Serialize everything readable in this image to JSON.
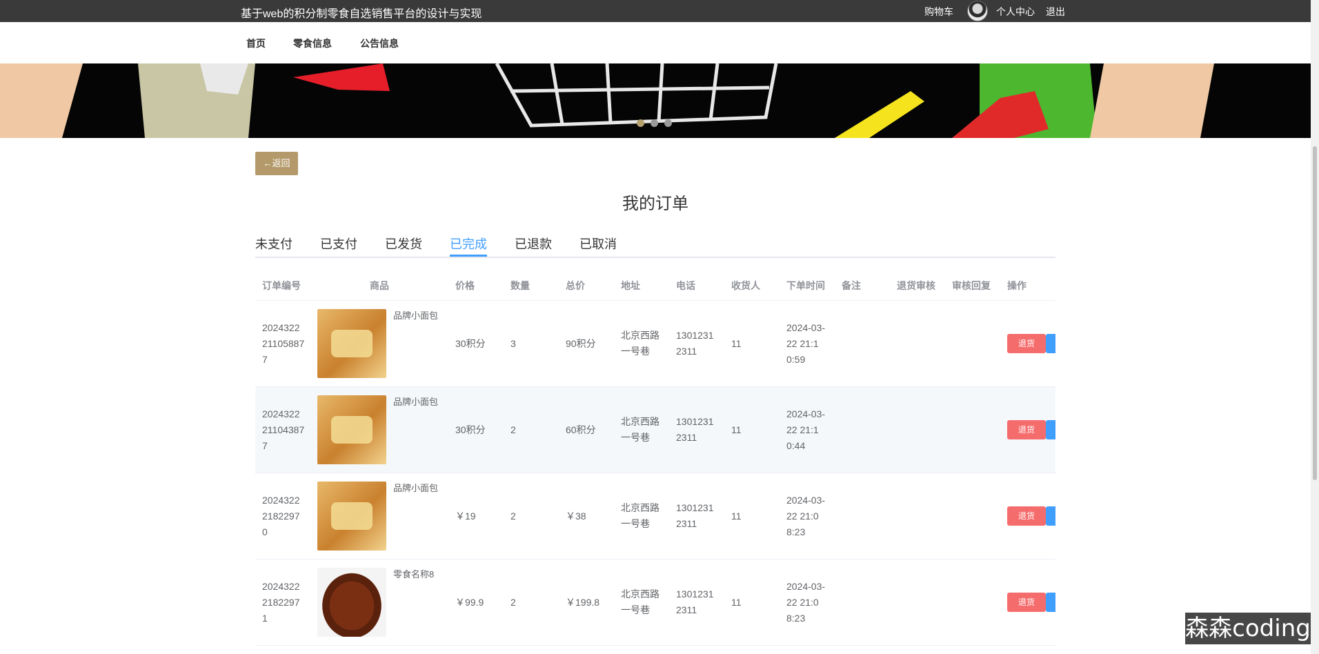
{
  "header": {
    "site_title": "基于web的积分制零食自选销售平台的设计与实现",
    "cart": "购物车",
    "user_center": "个人中心",
    "logout": "退出"
  },
  "nav": {
    "items": [
      "首页",
      "零食信息",
      "公告信息"
    ]
  },
  "banner": {
    "active_dot": 0,
    "dot_count": 3
  },
  "page": {
    "back_label": "←返回",
    "title": "我的订单",
    "tabs": [
      "未支付",
      "已支付",
      "已发货",
      "已完成",
      "已退款",
      "已取消"
    ],
    "active_tab": "已完成"
  },
  "table": {
    "columns": [
      "订单编号",
      "商品",
      "价格",
      "数量",
      "总价",
      "地址",
      "电话",
      "收货人",
      "下单时间",
      "备注",
      "退货审核",
      "审核回复",
      "操作"
    ],
    "rows": [
      {
        "order_no": "2024322211058877",
        "product": "品牌小面包",
        "image": "bread-icon",
        "price": "30积分",
        "qty": "3",
        "total": "90积分",
        "address": "北京西路一号巷",
        "phone": "13012312311",
        "receiver": "11",
        "time": "2024-03-22 21:10:59",
        "note": "",
        "audit": "",
        "reply": "",
        "action": "退货"
      },
      {
        "order_no": "2024322211043877",
        "product": "品牌小面包",
        "image": "bread-icon",
        "price": "30积分",
        "qty": "2",
        "total": "60积分",
        "address": "北京西路一号巷",
        "phone": "13012312311",
        "receiver": "11",
        "time": "2024-03-22 21:10:44",
        "note": "",
        "audit": "",
        "reply": "",
        "action": "退货"
      },
      {
        "order_no": "202432221822970",
        "product": "品牌小面包",
        "image": "bread-icon",
        "price": "￥19",
        "qty": "2",
        "total": "￥38",
        "address": "北京西路一号巷",
        "phone": "13012312311",
        "receiver": "11",
        "time": "2024-03-22 21:08:23",
        "note": "",
        "audit": "",
        "reply": "",
        "action": "退货"
      },
      {
        "order_no": "202432221822971",
        "product": "零食名称8",
        "image": "jerky-icon",
        "price": "￥99.9",
        "qty": "2",
        "total": "￥199.8",
        "address": "北京西路一号巷",
        "phone": "13012312311",
        "receiver": "11",
        "time": "2024-03-22 21:08:23",
        "note": "",
        "audit": "",
        "reply": "",
        "action": "退货"
      }
    ]
  },
  "watermark": "森森coding",
  "colors": {
    "accent": "#409eff",
    "danger": "#f56c6c",
    "brand": "#b49a6a",
    "topbar": "#3a3a3a"
  }
}
